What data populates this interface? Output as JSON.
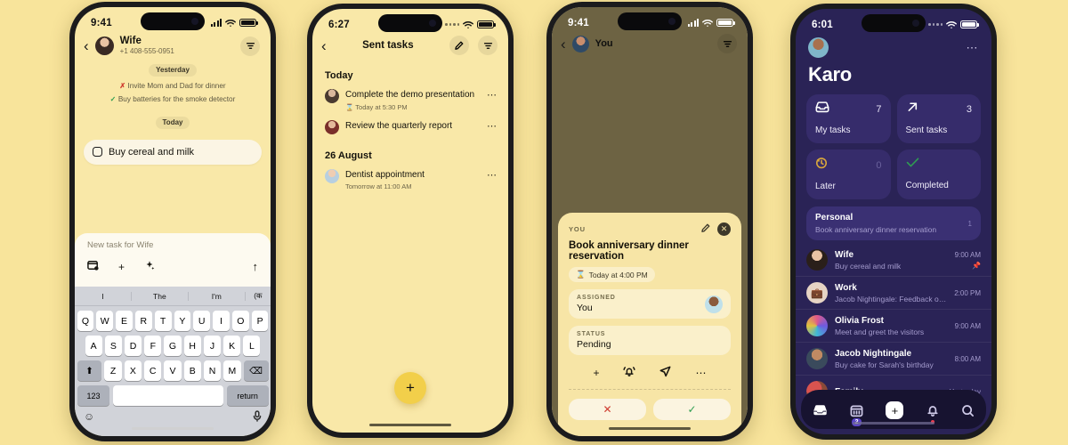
{
  "background_color": "#f8e49b",
  "phone1": {
    "status": {
      "time": "9:41"
    },
    "header": {
      "name": "Wife",
      "phone": "+1 408-555-0951"
    },
    "messages": [
      {
        "type": "daypill",
        "text": "Yesterday"
      },
      {
        "type": "msg",
        "mark": "x",
        "text": "Invite Mom and Dad for dinner"
      },
      {
        "type": "msg",
        "mark": "check",
        "text": "Buy batteries for the smoke detector"
      },
      {
        "type": "daypill",
        "text": "Today"
      }
    ],
    "task_bubble": {
      "text": "Buy cereal and milk",
      "checked": false
    },
    "composer": {
      "placeholder": "New task for Wife",
      "icons": [
        "calendar-settings-icon",
        "plus-icon",
        "sparkle-icon"
      ],
      "send_icon": "arrow-up-icon"
    },
    "keyboard": {
      "suggestions": [
        "I",
        "The",
        "I'm",
        "(क"
      ],
      "row1": [
        "Q",
        "W",
        "E",
        "R",
        "T",
        "Y",
        "U",
        "I",
        "O",
        "P"
      ],
      "row2": [
        "A",
        "S",
        "D",
        "F",
        "G",
        "H",
        "J",
        "K",
        "L"
      ],
      "row3": [
        "Z",
        "X",
        "C",
        "V",
        "B",
        "N",
        "M"
      ],
      "shift": "⬆",
      "backspace": "⌫",
      "num_key": "123",
      "space_key": "",
      "return_key": "return",
      "emoji_key": "emoji-icon",
      "mic_key": "microphone-icon"
    }
  },
  "phone2": {
    "status": {
      "time": "6:27"
    },
    "header": {
      "title": "Sent tasks",
      "edit_icon": "pencil-icon",
      "filter_icon": "filter-icon"
    },
    "sections": [
      {
        "title": "Today",
        "items": [
          {
            "title": "Complete the demo presentation",
            "sub": "Today at 5:30 PM",
            "has_timer": true
          },
          {
            "title": "Review the quarterly report",
            "sub": "",
            "has_timer": false
          }
        ]
      },
      {
        "title": "26 August",
        "items": [
          {
            "title": "Dentist appointment",
            "sub": "Tomorrow at 11:00 AM",
            "has_timer": false
          }
        ]
      }
    ],
    "fab": {
      "icon": "plus-icon"
    }
  },
  "phone3": {
    "status": {
      "time": "9:41"
    },
    "header": {
      "name": "You",
      "filter_icon": "filter-icon"
    },
    "sheet": {
      "label": "YOU",
      "edit_icon": "pencil-icon",
      "close_icon": "close-icon",
      "title": "Book anniversary dinner reservation",
      "due_chip": "Today at 4:00 PM",
      "fields": [
        {
          "label": "ASSIGNED",
          "value": "You",
          "has_avatar": true
        },
        {
          "label": "STATUS",
          "value": "Pending",
          "has_avatar": false
        }
      ],
      "actions": [
        "plus-icon",
        "bell-ring-icon",
        "send-icon",
        "more-icon"
      ],
      "buttons": [
        {
          "name": "reject",
          "glyph": "✕",
          "kind": "x"
        },
        {
          "name": "accept",
          "glyph": "✓",
          "kind": "v"
        }
      ]
    }
  },
  "phone4": {
    "status": {
      "time": "6:01"
    },
    "header": {
      "title": "Karo",
      "more_icon": "more-icon",
      "avatar": "user-avatar"
    },
    "stat_cards": [
      {
        "icon": "inbox-icon",
        "count": "7",
        "label": "My tasks",
        "dim": false
      },
      {
        "icon": "arrow-up-right-icon",
        "count": "3",
        "label": "Sent tasks",
        "dim": false
      },
      {
        "icon": "clock-back-icon",
        "count": "0",
        "label": "Later",
        "dim": true
      },
      {
        "icon": "check-icon",
        "count": "",
        "label": "Completed",
        "dim": false
      }
    ],
    "pinned": {
      "title": "Personal",
      "subtitle": "Book anniversary dinner reservation",
      "count": "1"
    },
    "chats": [
      {
        "name": "Wife",
        "message": "Buy cereal and milk",
        "time": "9:00 AM",
        "pinned": true
      },
      {
        "name": "Work",
        "message": "Jacob Nightingale: Feedback on sales rep...",
        "time": "2:00 PM",
        "pinned": false
      },
      {
        "name": "Olivia Frost",
        "message": "Meet and greet the visitors",
        "time": "9:00 AM",
        "pinned": false
      },
      {
        "name": "Jacob Nightingale",
        "message": "Buy cake for Sarah's birthday",
        "time": "8:00 AM",
        "pinned": false
      },
      {
        "name": "Family",
        "message": "",
        "time": "Yesterday",
        "pinned": false
      }
    ],
    "tabs": [
      {
        "icon": "inbox-icon",
        "badge": "",
        "dot": false
      },
      {
        "icon": "calendar-icon",
        "badge": "2",
        "dot": false
      },
      {
        "icon": "plus-icon",
        "badge": "",
        "dot": false
      },
      {
        "icon": "bell-icon",
        "badge": "",
        "dot": true
      },
      {
        "icon": "search-icon",
        "badge": "",
        "dot": false
      }
    ]
  }
}
